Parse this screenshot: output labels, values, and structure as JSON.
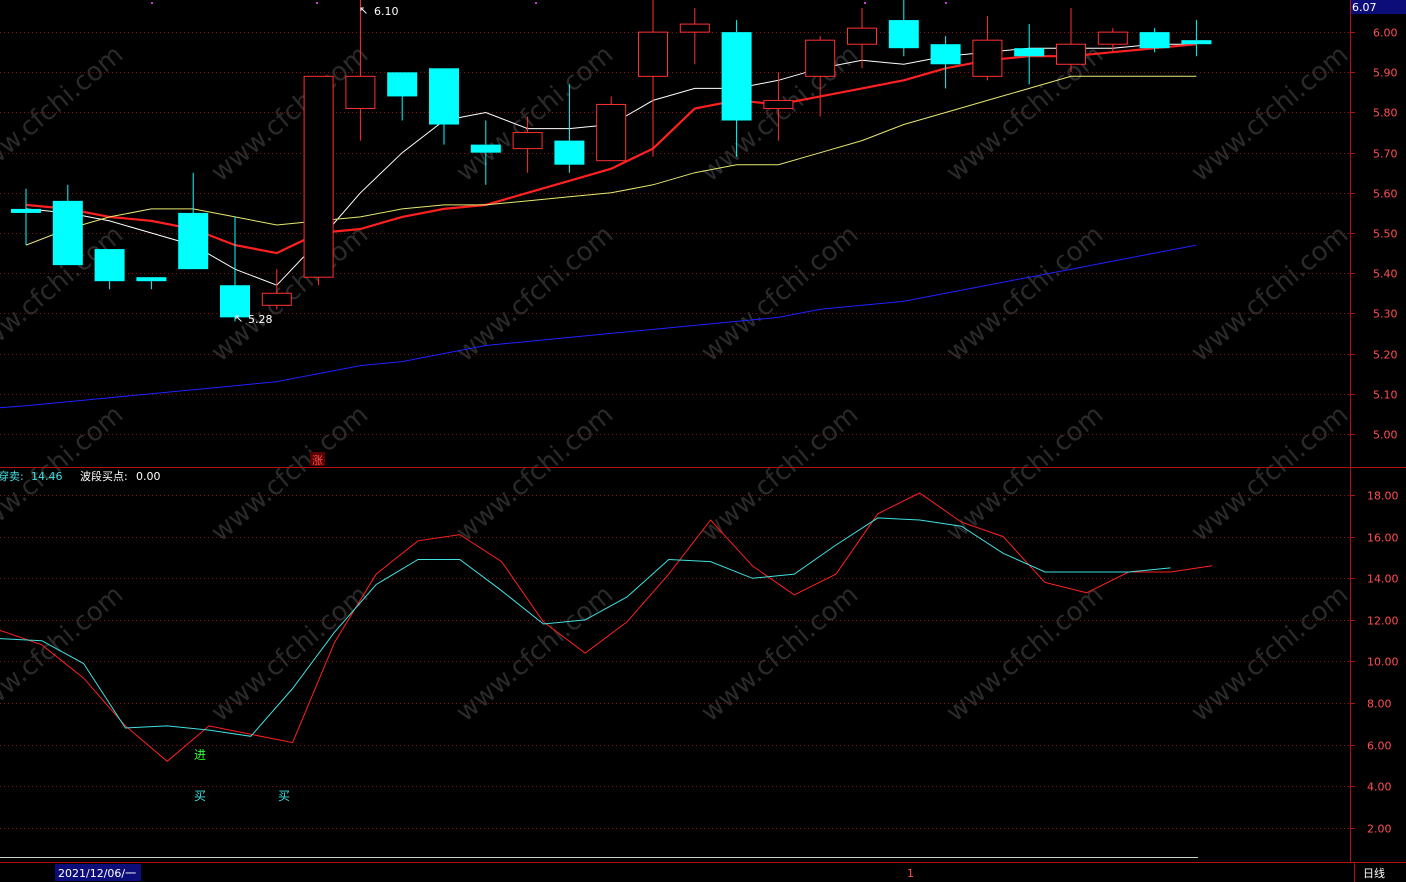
{
  "colors": {
    "background": "#000000",
    "up": "#ff3030",
    "down": "#00ffff",
    "ma_white": "#ffffff",
    "ma_red": "#ff2020",
    "ma_yellow": "#e8e870",
    "ma_blue": "#2020ff",
    "grid": "#8a1010",
    "axis": "#b01010",
    "ind_red": "#ff2020",
    "ind_cyan": "#40e0e0"
  },
  "header_value": "6.07",
  "price_labels": {
    "high": "6.10",
    "low": "5.28"
  },
  "zhang_marker": "涨",
  "indicator_header": {
    "label1": "穿卖:",
    "value1": "14.46",
    "label2": "波段买点:",
    "value2": "0.00"
  },
  "signals": {
    "jin": "进",
    "mai1": "买",
    "mai2": "买"
  },
  "date_label": "2021/12/06/一",
  "period_label": "日线",
  "cursor_label": "1",
  "watermark_text": "www.cfchi.com",
  "chart_data": [
    {
      "type": "candlestick",
      "ylim": [
        4.92,
        6.08
      ],
      "y_ticks": [
        "6.00",
        "5.90",
        "5.80",
        "5.70",
        "5.60",
        "5.50",
        "5.40",
        "5.30",
        "5.20",
        "5.10",
        "5.00"
      ],
      "candles": [
        {
          "o": 5.56,
          "c": 5.55,
          "h": 5.61,
          "l": 5.47
        },
        {
          "o": 5.58,
          "c": 5.42,
          "h": 5.62,
          "l": 5.42
        },
        {
          "o": 5.46,
          "c": 5.38,
          "h": 5.46,
          "l": 5.36
        },
        {
          "o": 5.39,
          "c": 5.38,
          "h": 5.39,
          "l": 5.36
        },
        {
          "o": 5.55,
          "c": 5.41,
          "h": 5.65,
          "l": 5.41
        },
        {
          "o": 5.37,
          "c": 5.29,
          "h": 5.54,
          "l": 5.28
        },
        {
          "o": 5.32,
          "c": 5.35,
          "h": 5.41,
          "l": 5.31
        },
        {
          "o": 5.39,
          "c": 5.89,
          "h": 5.89,
          "l": 5.37
        },
        {
          "o": 5.81,
          "c": 5.89,
          "h": 6.1,
          "l": 5.73
        },
        {
          "o": 5.9,
          "c": 5.84,
          "h": 5.9,
          "l": 5.78
        },
        {
          "o": 5.91,
          "c": 5.77,
          "h": 5.91,
          "l": 5.72
        },
        {
          "o": 5.72,
          "c": 5.7,
          "h": 5.78,
          "l": 5.62
        },
        {
          "o": 5.71,
          "c": 5.75,
          "h": 5.79,
          "l": 5.65
        },
        {
          "o": 5.73,
          "c": 5.67,
          "h": 5.87,
          "l": 5.65
        },
        {
          "o": 5.68,
          "c": 5.82,
          "h": 5.84,
          "l": 5.68
        },
        {
          "o": 5.89,
          "c": 6.0,
          "h": 6.09,
          "l": 5.69
        },
        {
          "o": 6.0,
          "c": 6.02,
          "h": 6.06,
          "l": 5.92
        },
        {
          "o": 6.0,
          "c": 5.78,
          "h": 6.03,
          "l": 5.69
        },
        {
          "o": 5.81,
          "c": 5.83,
          "h": 5.9,
          "l": 5.73
        },
        {
          "o": 5.89,
          "c": 5.98,
          "h": 5.99,
          "l": 5.79
        },
        {
          "o": 5.97,
          "c": 6.01,
          "h": 6.06,
          "l": 5.91
        },
        {
          "o": 6.03,
          "c": 5.96,
          "h": 6.09,
          "l": 5.94
        },
        {
          "o": 5.97,
          "c": 5.92,
          "h": 5.99,
          "l": 5.86
        },
        {
          "o": 5.89,
          "c": 5.98,
          "h": 6.04,
          "l": 5.88
        },
        {
          "o": 5.96,
          "c": 5.94,
          "h": 6.02,
          "l": 5.87
        },
        {
          "o": 5.92,
          "c": 5.97,
          "h": 6.06,
          "l": 5.9
        },
        {
          "o": 5.97,
          "c": 6.0,
          "h": 6.01,
          "l": 5.95
        },
        {
          "o": 6.0,
          "c": 5.96,
          "h": 6.01,
          "l": 5.95
        },
        {
          "o": 5.98,
          "c": 5.97,
          "h": 6.03,
          "l": 5.94
        }
      ],
      "ma_series": [
        {
          "key": "ma_white",
          "values": [
            5.56,
            5.55,
            5.53,
            5.5,
            5.47,
            5.41,
            5.37,
            5.48,
            5.6,
            5.7,
            5.78,
            5.8,
            5.76,
            5.76,
            5.77,
            5.83,
            5.86,
            5.86,
            5.88,
            5.91,
            5.93,
            5.92,
            5.94,
            5.95,
            5.96,
            5.96,
            5.96,
            5.97,
            5.97
          ]
        },
        {
          "key": "ma_red",
          "values": [
            5.57,
            5.56,
            5.54,
            5.53,
            5.51,
            5.47,
            5.45,
            5.5,
            5.51,
            5.54,
            5.56,
            5.57,
            5.6,
            5.63,
            5.66,
            5.71,
            5.81,
            5.83,
            5.82,
            5.84,
            5.86,
            5.88,
            5.91,
            5.93,
            5.94,
            5.94,
            5.95,
            5.96,
            5.97
          ]
        },
        {
          "key": "ma_yellow",
          "values": [
            5.47,
            5.51,
            5.54,
            5.56,
            5.56,
            5.54,
            5.52,
            5.53,
            5.54,
            5.56,
            5.57,
            5.57,
            5.58,
            5.59,
            5.6,
            5.62,
            5.65,
            5.67,
            5.67,
            5.7,
            5.73,
            5.77,
            5.8,
            5.83,
            5.86,
            5.89,
            5.89,
            5.89,
            5.89
          ]
        },
        {
          "key": "ma_blue",
          "values": [
            5.07,
            5.08,
            5.09,
            5.1,
            5.11,
            5.12,
            5.13,
            5.15,
            5.17,
            5.18,
            5.2,
            5.22,
            5.23,
            5.24,
            5.25,
            5.26,
            5.27,
            5.28,
            5.29,
            5.31,
            5.32,
            5.33,
            5.35,
            5.37,
            5.39,
            5.41,
            5.43,
            5.45,
            5.47
          ]
        }
      ]
    },
    {
      "type": "line",
      "ylim": [
        0.6,
        19.3
      ],
      "y_ticks": [
        "18.00",
        "16.00",
        "14.00",
        "12.00",
        "10.00",
        "8.00",
        "6.00",
        "4.00",
        "2.00"
      ],
      "series": [
        {
          "key": "ind_red",
          "values": [
            11.5,
            10.8,
            9.2,
            6.9,
            5.2,
            6.9,
            6.5,
            6.1,
            10.9,
            14.2,
            15.8,
            16.1,
            14.8,
            11.9,
            10.4,
            11.9,
            14.2,
            16.8,
            14.6,
            13.2,
            14.2,
            17.1,
            18.1,
            16.7,
            16.0,
            13.8,
            13.3,
            14.3,
            14.3,
            14.6
          ]
        },
        {
          "key": "ind_cyan",
          "values": [
            11.1,
            11.0,
            9.9,
            6.8,
            6.9,
            6.7,
            6.4,
            8.7,
            11.4,
            13.7,
            14.9,
            14.9,
            13.4,
            11.8,
            12.0,
            13.1,
            14.9,
            14.8,
            14.0,
            14.2,
            15.6,
            16.9,
            16.8,
            16.5,
            15.2,
            14.3,
            14.3,
            14.3,
            14.5
          ]
        }
      ]
    }
  ]
}
